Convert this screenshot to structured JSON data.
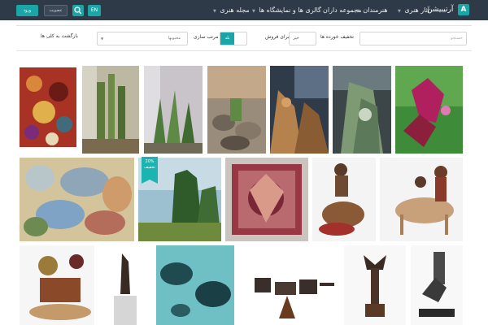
{
  "nav": {
    "brand": "آرتیبیشن",
    "logo_letter": "A",
    "menu": [
      "آثار هنری",
      "هنرمندان",
      "مجموعه داران",
      "گالری ها و نمایشگاه ها",
      "مجله هنری"
    ],
    "login_label": "ورود",
    "register_label": "عضویت",
    "lang_label": "EN",
    "colors": {
      "bar": "#2e3a48",
      "accent": "#1aa6a6"
    }
  },
  "filter": {
    "search_placeholder": "جستجو",
    "hide_label": "تخفیف خورده ها",
    "hide_value": "خیر",
    "for_sale_label": "برای فروش",
    "for_sale_value": "بله",
    "sort_label": "مرتب سازی",
    "sort_value": "محبوبها",
    "reset_label": "بازگشت به کلی ها"
  },
  "gallery": {
    "discount_badge_line1": "20%",
    "discount_badge_line2": "تخفیف",
    "artworks": [
      {
        "name": "artwork-1",
        "kind": "painting"
      },
      {
        "name": "artwork-2",
        "kind": "photograph"
      },
      {
        "name": "artwork-3",
        "kind": "photograph"
      },
      {
        "name": "artwork-4",
        "kind": "photograph"
      },
      {
        "name": "artwork-5",
        "kind": "photograph"
      },
      {
        "name": "artwork-6",
        "kind": "photograph"
      },
      {
        "name": "artwork-7",
        "kind": "sculpture"
      },
      {
        "name": "artwork-8",
        "kind": "painting"
      },
      {
        "name": "artwork-9",
        "kind": "painting"
      },
      {
        "name": "artwork-10",
        "kind": "painting"
      },
      {
        "name": "artwork-11",
        "kind": "sculpture"
      },
      {
        "name": "artwork-12",
        "kind": "sculpture"
      },
      {
        "name": "artwork-13",
        "kind": "sculpture"
      },
      {
        "name": "artwork-14",
        "kind": "sculpture"
      },
      {
        "name": "artwork-15",
        "kind": "painting"
      },
      {
        "name": "artwork-16",
        "kind": "sculpture"
      },
      {
        "name": "artwork-17",
        "kind": "sculpture"
      },
      {
        "name": "artwork-18",
        "kind": "sculpture"
      }
    ]
  }
}
